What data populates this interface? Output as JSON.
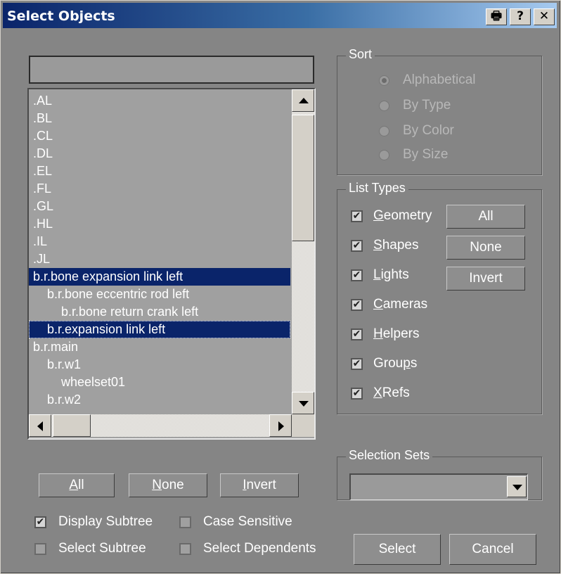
{
  "window": {
    "title": "Select Objects"
  },
  "titlebar_buttons": {
    "print": "🖶",
    "help": "?",
    "close": "✕"
  },
  "filter": {
    "value": ""
  },
  "list": {
    "items": [
      {
        "label": ".AL",
        "indent": 0
      },
      {
        "label": ".BL",
        "indent": 0
      },
      {
        "label": ".CL",
        "indent": 0
      },
      {
        "label": ".DL",
        "indent": 0
      },
      {
        "label": ".EL",
        "indent": 0
      },
      {
        "label": ".FL",
        "indent": 0
      },
      {
        "label": ".GL",
        "indent": 0
      },
      {
        "label": ".HL",
        "indent": 0
      },
      {
        "label": ".IL",
        "indent": 0
      },
      {
        "label": ".JL",
        "indent": 0
      },
      {
        "label": "b.r.bone expansion link left",
        "indent": 0,
        "selected": true
      },
      {
        "label": "b.r.bone eccentric rod left",
        "indent": 1
      },
      {
        "label": "b.r.bone return crank left",
        "indent": 2
      },
      {
        "label": "b.r.expansion link left",
        "indent": 1,
        "selected": true,
        "focused": true
      },
      {
        "label": "b.r.main",
        "indent": 0
      },
      {
        "label": "b.r.w1",
        "indent": 1
      },
      {
        "label": "wheelset01",
        "indent": 2
      },
      {
        "label": "b.r.w2",
        "indent": 1
      }
    ]
  },
  "sort": {
    "legend": "Sort",
    "options": [
      {
        "label": "Alphabetical",
        "selected": true
      },
      {
        "label": "By Type",
        "selected": false
      },
      {
        "label": "By Color",
        "selected": false
      },
      {
        "label": "By Size",
        "selected": false
      }
    ]
  },
  "list_types": {
    "legend": "List Types",
    "items": [
      {
        "label": "Geometry",
        "ul": "G",
        "rest": "eometry",
        "checked": true
      },
      {
        "label": "Shapes",
        "ul": "S",
        "rest": "hapes",
        "checked": true
      },
      {
        "label": "Lights",
        "ul": "L",
        "rest": "ights",
        "checked": true
      },
      {
        "label": "Cameras",
        "ul": "C",
        "rest": "ameras",
        "checked": true
      },
      {
        "label": "Helpers",
        "ul": "H",
        "rest": "elpers",
        "checked": true
      },
      {
        "label": "Groups",
        "pre": "Grou",
        "ul": "p",
        "rest": "s",
        "checked": true
      },
      {
        "label": "XRefs",
        "ul": "X",
        "rest": "Refs",
        "checked": true
      }
    ],
    "buttons": {
      "all": "All",
      "none": "None",
      "invert": "Invert"
    }
  },
  "selection_sets": {
    "legend": "Selection Sets",
    "value": ""
  },
  "bottom": {
    "all_ul": "A",
    "all_rest": "ll",
    "none_ul": "N",
    "none_rest": "one",
    "invert_ul": "I",
    "invert_rest": "nvert",
    "display_subtree": {
      "label": "Display Subtree",
      "checked": true
    },
    "case_sensitive": {
      "label": "Case Sensitive",
      "checked": false
    },
    "select_subtree": {
      "label": "Select Subtree",
      "checked": false
    },
    "select_dependents": {
      "label": "Select Dependents",
      "checked": false
    },
    "select": "Select",
    "cancel": "Cancel"
  },
  "colors": {
    "selection": "#0a246a",
    "dialog_bg": "#858585",
    "title_start": "#0a246a",
    "title_end": "#a6caf0"
  }
}
